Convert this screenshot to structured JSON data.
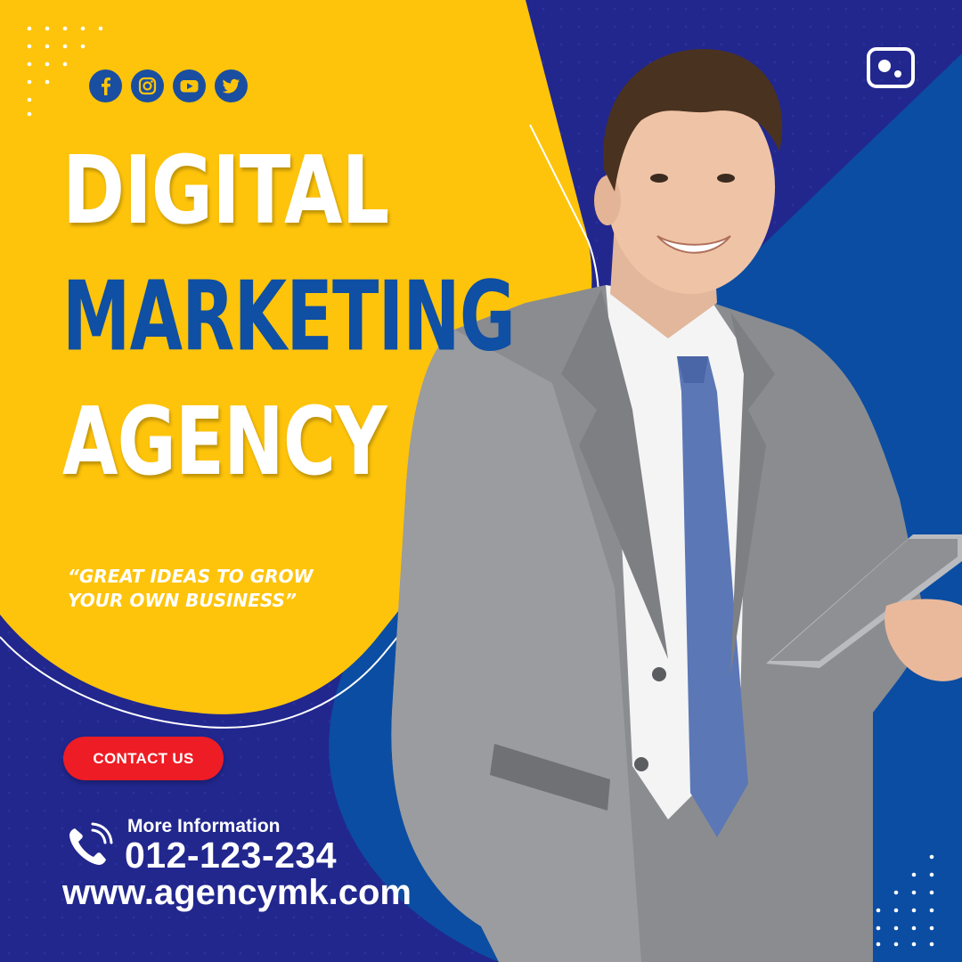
{
  "social": {
    "icons": [
      {
        "name": "facebook-icon"
      },
      {
        "name": "instagram-icon"
      },
      {
        "name": "youtube-icon"
      },
      {
        "name": "twitter-icon"
      }
    ]
  },
  "headline": {
    "line1": "DIGITAL",
    "line2": "MARKETING",
    "line3": "AGENCY"
  },
  "tagline": {
    "line1": "“GREAT IDEAS TO GROW",
    "line2": "YOUR OWN BUSINESS”"
  },
  "cta": {
    "label": "CONTACT US"
  },
  "contact": {
    "label": "More Information",
    "phone": "012-123-234",
    "website": "www.agencymk.com"
  },
  "colors": {
    "yellow": "#fec40b",
    "navy": "#22278e",
    "blue": "#0b4da2",
    "red": "#ee1c24"
  }
}
